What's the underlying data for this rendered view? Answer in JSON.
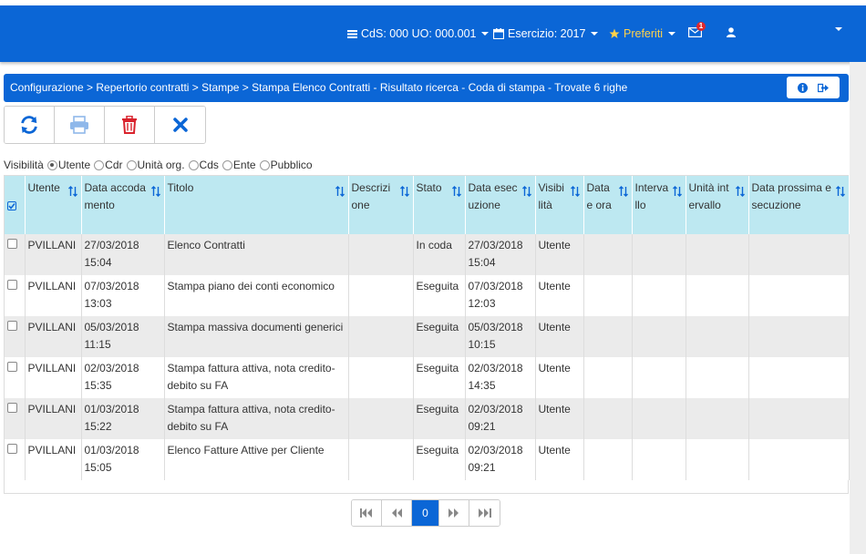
{
  "navbar": {
    "cds": "CdS: 000 UO: 000.001",
    "esercizio": "Esercizio: 2017",
    "preferiti": "Preferiti",
    "messages_count": "1"
  },
  "breadcrumb": {
    "text": "Configurazione > Repertorio contratti > Stampe > Stampa Elenco Contratti - Risultato ricerca - Coda di stampa - Trovate 6 righe"
  },
  "visibility": {
    "label": "Visibilità",
    "options": [
      "Utente",
      "Cdr",
      "Unità org.",
      "Cds",
      "Ente",
      "Pubblico"
    ],
    "selected": "Utente"
  },
  "table": {
    "headers": [
      "Utente",
      "Data accodamento",
      "Titolo",
      "Descrizione",
      "Stato",
      "Data esecuzione",
      "Visibilità",
      "Data e ora",
      "Intervallo",
      "Unità intervallo",
      "Data prossima esecuzione"
    ],
    "rows": [
      {
        "utente": "PVILLANI",
        "data_acc_d": "27/03/2018",
        "data_acc_t": "15:04",
        "titolo": "Elenco Contratti",
        "descrizione": "",
        "stato": "In coda",
        "data_es_d": "27/03/2018",
        "data_es_t": "15:04",
        "visibilita": "Utente"
      },
      {
        "utente": "PVILLANI",
        "data_acc_d": "07/03/2018",
        "data_acc_t": "13:03",
        "titolo": "Stampa piano dei conti economico",
        "descrizione": "",
        "stato": "Eseguita",
        "data_es_d": "07/03/2018",
        "data_es_t": "12:03",
        "visibilita": "Utente"
      },
      {
        "utente": "PVILLANI",
        "data_acc_d": "05/03/2018",
        "data_acc_t": "11:15",
        "titolo": "Stampa massiva documenti generici",
        "descrizione": "",
        "stato": "Eseguita",
        "data_es_d": "05/03/2018",
        "data_es_t": "10:15",
        "visibilita": "Utente"
      },
      {
        "utente": "PVILLANI",
        "data_acc_d": "02/03/2018",
        "data_acc_t": "15:35",
        "titolo": "Stampa fattura attiva, nota credito-debito su FA",
        "descrizione": "",
        "stato": "Eseguita",
        "data_es_d": "02/03/2018",
        "data_es_t": "14:35",
        "visibilita": "Utente"
      },
      {
        "utente": "PVILLANI",
        "data_acc_d": "01/03/2018",
        "data_acc_t": "15:22",
        "titolo": "Stampa fattura attiva, nota credito-debito su FA",
        "descrizione": "",
        "stato": "Eseguita",
        "data_es_d": "02/03/2018",
        "data_es_t": "09:21",
        "visibilita": "Utente"
      },
      {
        "utente": "PVILLANI",
        "data_acc_d": "01/03/2018",
        "data_acc_t": "15:05",
        "titolo": "Elenco Fatture Attive per Cliente",
        "descrizione": "",
        "stato": "Eseguita",
        "data_es_d": "02/03/2018",
        "data_es_t": "09:21",
        "visibilita": "Utente"
      }
    ]
  },
  "pager": {
    "current_page": "0"
  },
  "colors": {
    "brand_blue": "#0b66d6",
    "header_cyan": "#bde8f1",
    "delete_red": "#d9232d"
  },
  "icons": {
    "toolbar": [
      "refresh-icon",
      "print-icon",
      "trash-icon",
      "close-icon"
    ],
    "breadcrumb": [
      "info-icon",
      "exit-icon"
    ]
  }
}
